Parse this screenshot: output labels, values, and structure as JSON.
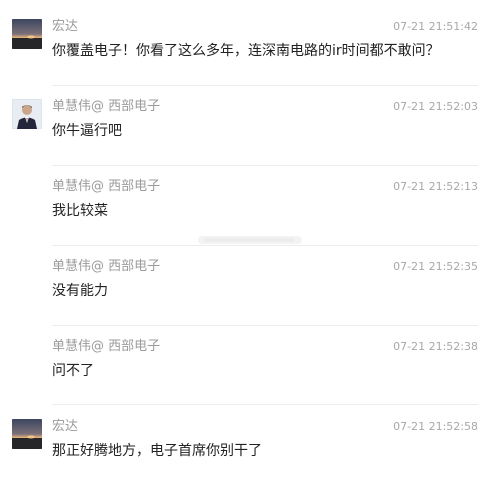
{
  "messages": [
    {
      "sender": "宏达",
      "time": "07-21 21:51:42",
      "text": "你覆盖电子！你看了这么多年，连深南电路的ir时间都不敢问？",
      "avatar": "sunset-photo"
    },
    {
      "sender": "单慧伟@ 西部电子",
      "time": "07-21 21:52:03",
      "text": "你牛逼行吧",
      "avatar": "person-photo"
    },
    {
      "sender": "单慧伟@ 西部电子",
      "time": "07-21 21:52:13",
      "text": "我比较菜",
      "avatar": ""
    },
    {
      "sender": "单慧伟@ 西部电子",
      "time": "07-21 21:52:35",
      "text": "没有能力",
      "avatar": ""
    },
    {
      "sender": "单慧伟@ 西部电子",
      "time": "07-21 21:52:38",
      "text": "问不了",
      "avatar": ""
    },
    {
      "sender": "宏达",
      "time": "07-21 21:52:58",
      "text": "那正好腾地方，电子首席你别干了",
      "avatar": "sunset-photo"
    }
  ]
}
